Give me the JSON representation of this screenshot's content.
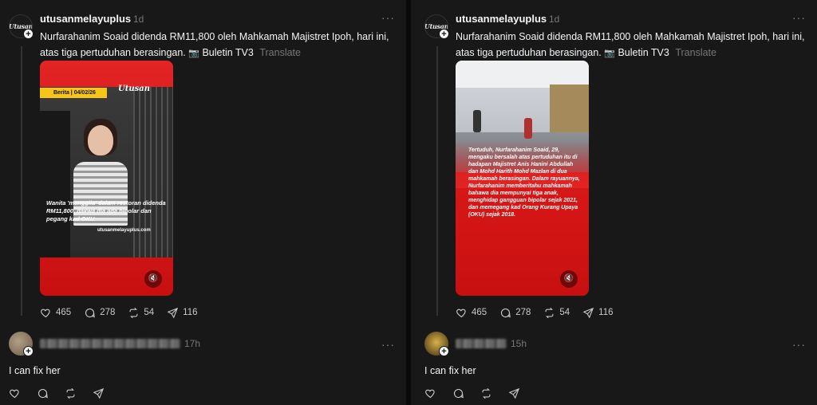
{
  "post": {
    "username": "utusanmelayuplus",
    "avatar_text": "Utusan",
    "time": "1d",
    "more": "···",
    "text": "Nurfarahanim Soaid didenda RM11,800 oleh Mahkamah Majistret Ipoh, hari ini, atas tiga pertuduhan berasingan.",
    "text_suffix": "Buletin TV3",
    "camera_icon": "📷",
    "translate": "Translate",
    "stats": {
      "likes": "465",
      "comments": "278",
      "reposts": "54",
      "shares": "116"
    }
  },
  "left_media": {
    "tag": "Berita | 04/02/26",
    "brand": "Utusan",
    "headline": "Wanita 'menggila' dalam restoran didenda RM11,800, dakwa dia ada bipolar dan pegang kad OKU",
    "site": "utusanmelayuplus.com",
    "mute_icon": "🔇"
  },
  "right_media": {
    "body": "Tertuduh, Nurfarahanim Soaid, 29, mengaku bersalah atas pertuduhan itu di hadapan Majistret Anis Hanini Abdullah dan Mohd Harith Mohd Mazlan di dua mahkamah berasingan. Dalam rayuannya, Nurfarahanim memberitahu mahkamah bahawa dia mempunyai tiga anak, menghidap gangguan bipolar sejak 2021, dan memegang kad Orang Kurang Upaya (OKU) sejak 2018.",
    "mute_icon": "🔇"
  },
  "replies": [
    {
      "time": "17h",
      "text": "I can fix her"
    },
    {
      "time": "15h",
      "text": "I can fix her"
    }
  ],
  "plus": "+"
}
